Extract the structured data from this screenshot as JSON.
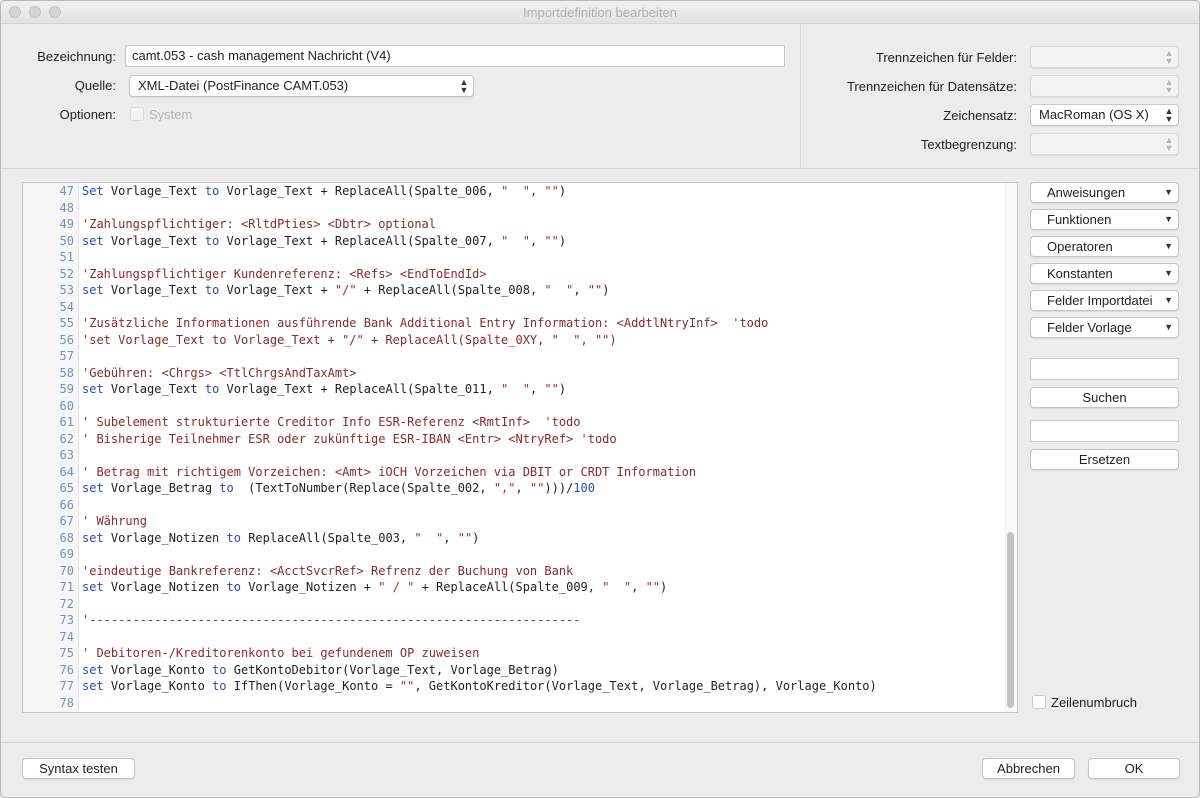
{
  "window": {
    "title": "Importdefinition bearbeiten"
  },
  "form": {
    "bezeichnung_label": "Bezeichnung:",
    "bezeichnung_value": "camt.053 - cash management Nachricht (V4)",
    "quelle_label": "Quelle:",
    "quelle_value": "XML-Datei (PostFinance CAMT.053)",
    "optionen_label": "Optionen:",
    "system_label": "System"
  },
  "right_form": {
    "trennzeichen_felder_label": "Trennzeichen für Felder:",
    "trennzeichen_datensaetze_label": "Trennzeichen für Datensätze:",
    "zeichensatz_label": "Zeichensatz:",
    "zeichensatz_value": "MacRoman (OS X)",
    "textbegrenzung_label": "Textbegrenzung:"
  },
  "colors": {
    "keyword": "#2a4ab8",
    "string": "#b02525",
    "comment": "#8b2a2a",
    "line_number": "#7a8fb5"
  },
  "editor": {
    "lines": [
      {
        "n": "47",
        "tokens": [
          [
            "kw",
            "Set"
          ],
          [
            "tx",
            " Vorlage_Text "
          ],
          [
            "kw",
            "to"
          ],
          [
            "tx",
            " Vorlage_Text + ReplaceAll(Spalte_006, "
          ],
          [
            "str",
            "\"  \""
          ],
          [
            "tx",
            ", "
          ],
          [
            "str",
            "\"\""
          ],
          [
            "tx",
            ")"
          ]
        ]
      },
      {
        "n": "48",
        "tokens": []
      },
      {
        "n": "49",
        "tokens": [
          [
            "cm",
            "'Zahlungspflichtiger: <RltdPties> <Dbtr> optional"
          ]
        ]
      },
      {
        "n": "50",
        "tokens": [
          [
            "kw",
            "set"
          ],
          [
            "tx",
            " Vorlage_Text "
          ],
          [
            "kw",
            "to"
          ],
          [
            "tx",
            " Vorlage_Text + ReplaceAll(Spalte_007, "
          ],
          [
            "str",
            "\"  \""
          ],
          [
            "tx",
            ", "
          ],
          [
            "str",
            "\"\""
          ],
          [
            "tx",
            ")"
          ]
        ]
      },
      {
        "n": "51",
        "tokens": []
      },
      {
        "n": "52",
        "tokens": [
          [
            "cm",
            "'Zahlungspflichtiger Kundenreferenz: <Refs> <EndToEndId>"
          ]
        ]
      },
      {
        "n": "53",
        "tokens": [
          [
            "kw",
            "set"
          ],
          [
            "tx",
            " Vorlage_Text "
          ],
          [
            "kw",
            "to"
          ],
          [
            "tx",
            " Vorlage_Text + "
          ],
          [
            "str",
            "\"/\""
          ],
          [
            "tx",
            " + ReplaceAll(Spalte_008, "
          ],
          [
            "str",
            "\"  \""
          ],
          [
            "tx",
            ", "
          ],
          [
            "str",
            "\"\""
          ],
          [
            "tx",
            ")"
          ]
        ]
      },
      {
        "n": "54",
        "tokens": []
      },
      {
        "n": "55",
        "tokens": [
          [
            "cm",
            "'Zusätzliche Informationen ausführende Bank Additional Entry Information: <AddtlNtryInf>  'todo"
          ]
        ]
      },
      {
        "n": "56",
        "tokens": [
          [
            "cm",
            "'set Vorlage_Text to Vorlage_Text + \"/\" + ReplaceAll(Spalte_0XY, \"  \", \"\")"
          ]
        ]
      },
      {
        "n": "57",
        "tokens": []
      },
      {
        "n": "58",
        "tokens": [
          [
            "cm",
            "'Gebühren: <Chrgs> <TtlChrgsAndTaxAmt>"
          ]
        ]
      },
      {
        "n": "59",
        "tokens": [
          [
            "kw",
            "set"
          ],
          [
            "tx",
            " Vorlage_Text "
          ],
          [
            "kw",
            "to"
          ],
          [
            "tx",
            " Vorlage_Text + ReplaceAll(Spalte_011, "
          ],
          [
            "str",
            "\"  \""
          ],
          [
            "tx",
            ", "
          ],
          [
            "str",
            "\"\""
          ],
          [
            "tx",
            ")"
          ]
        ]
      },
      {
        "n": "60",
        "tokens": []
      },
      {
        "n": "61",
        "tokens": [
          [
            "cm",
            "' Subelement strukturierte Creditor Info ESR-Referenz <RmtInf>  'todo"
          ]
        ]
      },
      {
        "n": "62",
        "tokens": [
          [
            "cm",
            "' Bisherige Teilnehmer ESR oder zukünftige ESR-IBAN <Entr> <NtryRef> 'todo"
          ]
        ]
      },
      {
        "n": "63",
        "tokens": []
      },
      {
        "n": "64",
        "tokens": [
          [
            "cm",
            "' Betrag mit richtigem Vorzeichen: <Amt> iOCH Vorzeichen via DBIT or CRDT Information"
          ]
        ]
      },
      {
        "n": "65",
        "tokens": [
          [
            "kw",
            "set"
          ],
          [
            "tx",
            " Vorlage_Betrag "
          ],
          [
            "kw",
            "to"
          ],
          [
            "tx",
            "  (TextToNumber(Replace(Spalte_002, "
          ],
          [
            "str",
            "\",\""
          ],
          [
            "tx",
            ", "
          ],
          [
            "str",
            "\"\""
          ],
          [
            "tx",
            ")))/"
          ],
          [
            "num",
            "100"
          ]
        ]
      },
      {
        "n": "66",
        "tokens": []
      },
      {
        "n": "67",
        "tokens": [
          [
            "cm",
            "' Währung"
          ]
        ]
      },
      {
        "n": "68",
        "tokens": [
          [
            "kw",
            "set"
          ],
          [
            "tx",
            " Vorlage_Notizen "
          ],
          [
            "kw",
            "to"
          ],
          [
            "tx",
            " ReplaceAll(Spalte_003, "
          ],
          [
            "str",
            "\"  \""
          ],
          [
            "tx",
            ", "
          ],
          [
            "str",
            "\"\""
          ],
          [
            "tx",
            ")"
          ]
        ]
      },
      {
        "n": "69",
        "tokens": []
      },
      {
        "n": "70",
        "tokens": [
          [
            "cm",
            "'eindeutige Bankreferenz: <AcctSvcrRef> Refrenz der Buchung von Bank"
          ]
        ]
      },
      {
        "n": "71",
        "tokens": [
          [
            "kw",
            "set"
          ],
          [
            "tx",
            " Vorlage_Notizen "
          ],
          [
            "kw",
            "to"
          ],
          [
            "tx",
            " Vorlage_Notizen + "
          ],
          [
            "str",
            "\" / \""
          ],
          [
            "tx",
            " + ReplaceAll(Spalte_009, "
          ],
          [
            "str",
            "\"  \""
          ],
          [
            "tx",
            ", "
          ],
          [
            "str",
            "\"\""
          ],
          [
            "tx",
            ")"
          ]
        ]
      },
      {
        "n": "72",
        "tokens": []
      },
      {
        "n": "73",
        "tokens": [
          [
            "cm",
            "'--------------------------------------------------------------------"
          ]
        ]
      },
      {
        "n": "74",
        "tokens": []
      },
      {
        "n": "75",
        "tokens": [
          [
            "cm",
            "' Debitoren-/Kreditorenkonto bei gefundenem OP zuweisen"
          ]
        ]
      },
      {
        "n": "76",
        "tokens": [
          [
            "kw",
            "set"
          ],
          [
            "tx",
            " Vorlage_Konto "
          ],
          [
            "kw",
            "to"
          ],
          [
            "tx",
            " GetKontoDebitor(Vorlage_Text, Vorlage_Betrag)"
          ]
        ]
      },
      {
        "n": "77",
        "tokens": [
          [
            "kw",
            "set"
          ],
          [
            "tx",
            " Vorlage_Konto "
          ],
          [
            "kw",
            "to"
          ],
          [
            "tx",
            " IfThen(Vorlage_Konto = "
          ],
          [
            "str",
            "\"\""
          ],
          [
            "tx",
            ", GetKontoKreditor(Vorlage_Text, Vorlage_Betrag), Vorlage_Konto)"
          ]
        ]
      },
      {
        "n": "78",
        "tokens": []
      }
    ]
  },
  "side": {
    "anweisungen": "Anweisungen",
    "funktionen": "Funktionen",
    "operatoren": "Operatoren",
    "konstanten": "Konstanten",
    "felder_importdatei": "Felder Importdatei",
    "felder_vorlage": "Felder Vorlage",
    "suchen": "Suchen",
    "ersetzen": "Ersetzen",
    "zeilenumbruch": "Zeilenumbruch"
  },
  "footer": {
    "syntax_testen": "Syntax testen",
    "abbrechen": "Abbrechen",
    "ok": "OK"
  }
}
